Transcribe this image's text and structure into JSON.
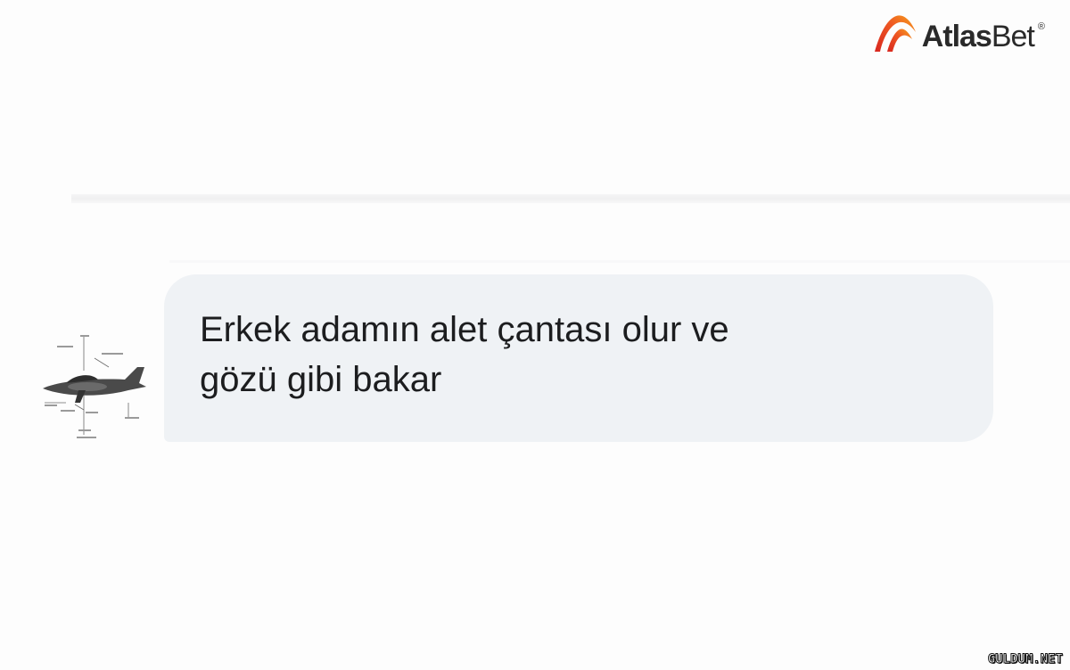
{
  "brand": {
    "name_bold": "Atlas",
    "name_regular": "Bet",
    "registered": "®",
    "accent_color": "#e8452b",
    "accent_color_2": "#f29a1e"
  },
  "message": {
    "lines": [
      "Erkek adamın alet çantası olur ve",
      "gözü gibi bakar"
    ],
    "bubble_color": "#eff2f5",
    "avatar_icon": "airplane-diagram-icon"
  },
  "watermark": {
    "text": "GULDUM.NET"
  }
}
